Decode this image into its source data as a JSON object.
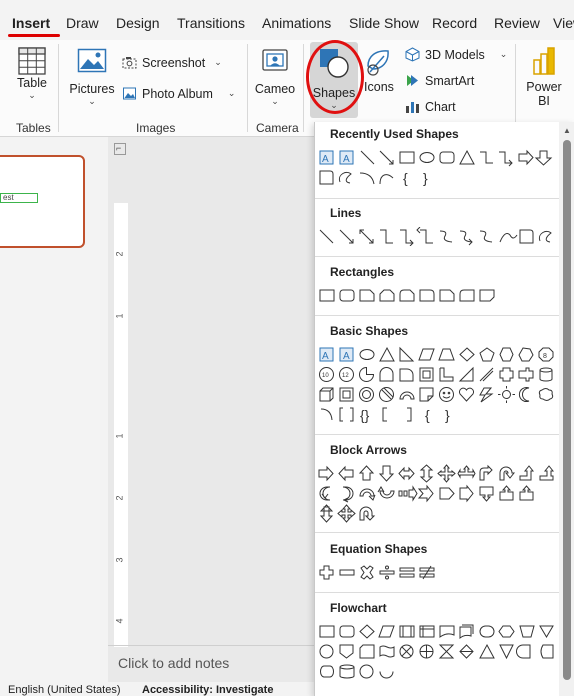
{
  "tabs": [
    {
      "label": "Insert",
      "active": true
    },
    {
      "label": "Draw"
    },
    {
      "label": "Design"
    },
    {
      "label": "Transitions"
    },
    {
      "label": "Animations"
    },
    {
      "label": "Slide Show"
    },
    {
      "label": "Record"
    },
    {
      "label": "Review"
    },
    {
      "label": "View"
    }
  ],
  "ribbon": {
    "table": {
      "label": "Table"
    },
    "pictures": {
      "label": "Pictures"
    },
    "screenshot": {
      "label": "Screenshot"
    },
    "photo_album": {
      "label": "Photo Album"
    },
    "cameo": {
      "label": "Cameo"
    },
    "shapes": {
      "label": "Shapes"
    },
    "icons": {
      "label": "Icons"
    },
    "models_3d": {
      "label": "3D Models"
    },
    "smartart": {
      "label": "SmartArt"
    },
    "chart": {
      "label": "Chart"
    },
    "powerbi": {
      "label_line1": "Power",
      "label_line2": "BI"
    },
    "groups": {
      "tables": "Tables",
      "images": "Images",
      "camera": "Camera"
    }
  },
  "thumbnail": {
    "text": "est"
  },
  "ruler": {
    "ticks": [
      "2",
      "1",
      "1",
      "2",
      "3",
      "4"
    ]
  },
  "notes": {
    "placeholder": "Click to add notes"
  },
  "status": {
    "language": "English (United States)",
    "accessibility": "Accessibility: Investigate"
  },
  "shapes_menu": {
    "sections": [
      {
        "title": "Recently Used Shapes"
      },
      {
        "title": "Lines"
      },
      {
        "title": "Rectangles"
      },
      {
        "title": "Basic Shapes"
      },
      {
        "title": "Block Arrows"
      },
      {
        "title": "Equation Shapes"
      },
      {
        "title": "Flowchart"
      }
    ]
  },
  "colors": {
    "accent": "#c0502c",
    "annotation": "#e01010",
    "icon_blue": "#2e75b6"
  }
}
